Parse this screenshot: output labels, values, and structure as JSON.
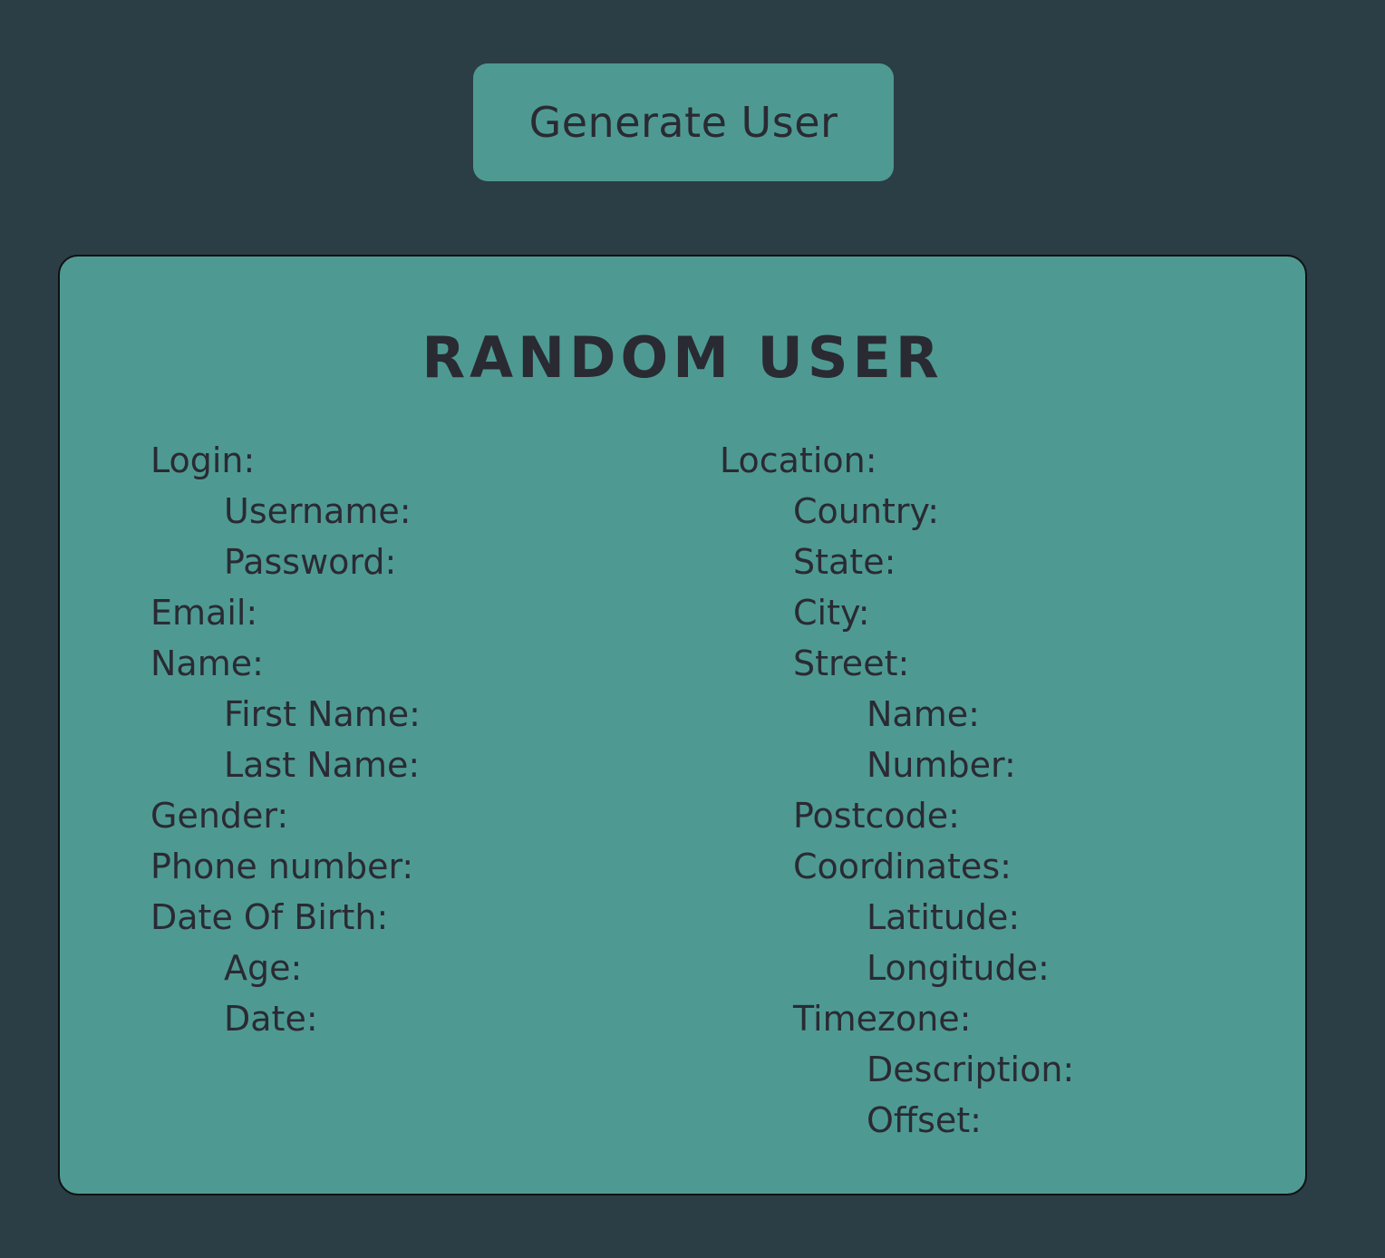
{
  "generate_button": {
    "label": "Generate User"
  },
  "card": {
    "title": "RANDOM USER",
    "left": {
      "login": "Login:",
      "username": "Username:",
      "password": "Password:",
      "email": "Email:",
      "name": "Name:",
      "first_name": "First Name:",
      "last_name": "Last Name:",
      "gender": "Gender:",
      "phone": "Phone number:",
      "dob": "Date Of Birth:",
      "age": "Age:",
      "date": "Date:"
    },
    "right": {
      "location": "Location:",
      "country": "Country:",
      "state": "State:",
      "city": "City:",
      "street": "Street:",
      "street_name": "Name:",
      "street_number": "Number:",
      "postcode": "Postcode:",
      "coordinates": "Coordinates:",
      "latitude": "Latitude:",
      "longitude": "Longitude:",
      "timezone": "Timezone:",
      "tz_description": "Description:",
      "tz_offset": "Offset:"
    }
  }
}
